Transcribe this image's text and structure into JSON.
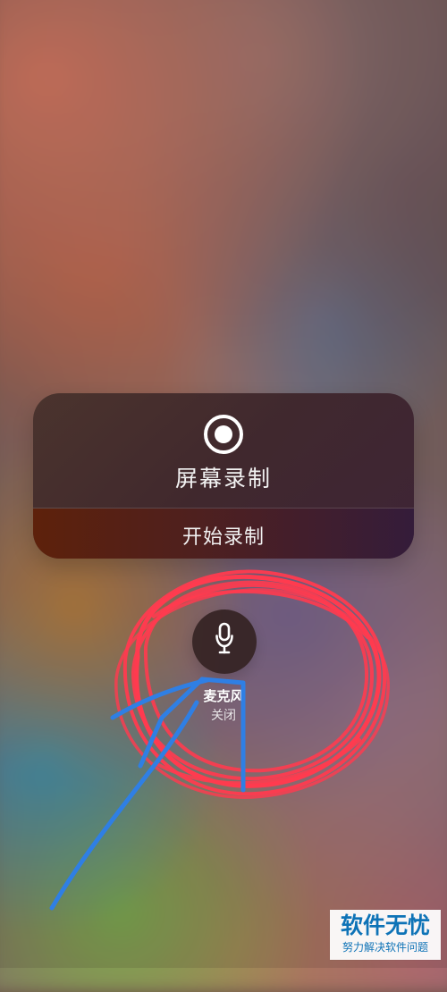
{
  "screen_recording": {
    "title": "屏幕录制",
    "start_label": "开始录制",
    "record_icon": "record-icon"
  },
  "microphone": {
    "label": "麦克风",
    "status": "关闭",
    "icon": "microphone-icon"
  },
  "annotations": {
    "circle_color": "#ff3b4f",
    "arrow_color": "#2f7fe4"
  },
  "watermark": {
    "title": "软件无忧",
    "subtitle": "努力解决软件问题"
  }
}
